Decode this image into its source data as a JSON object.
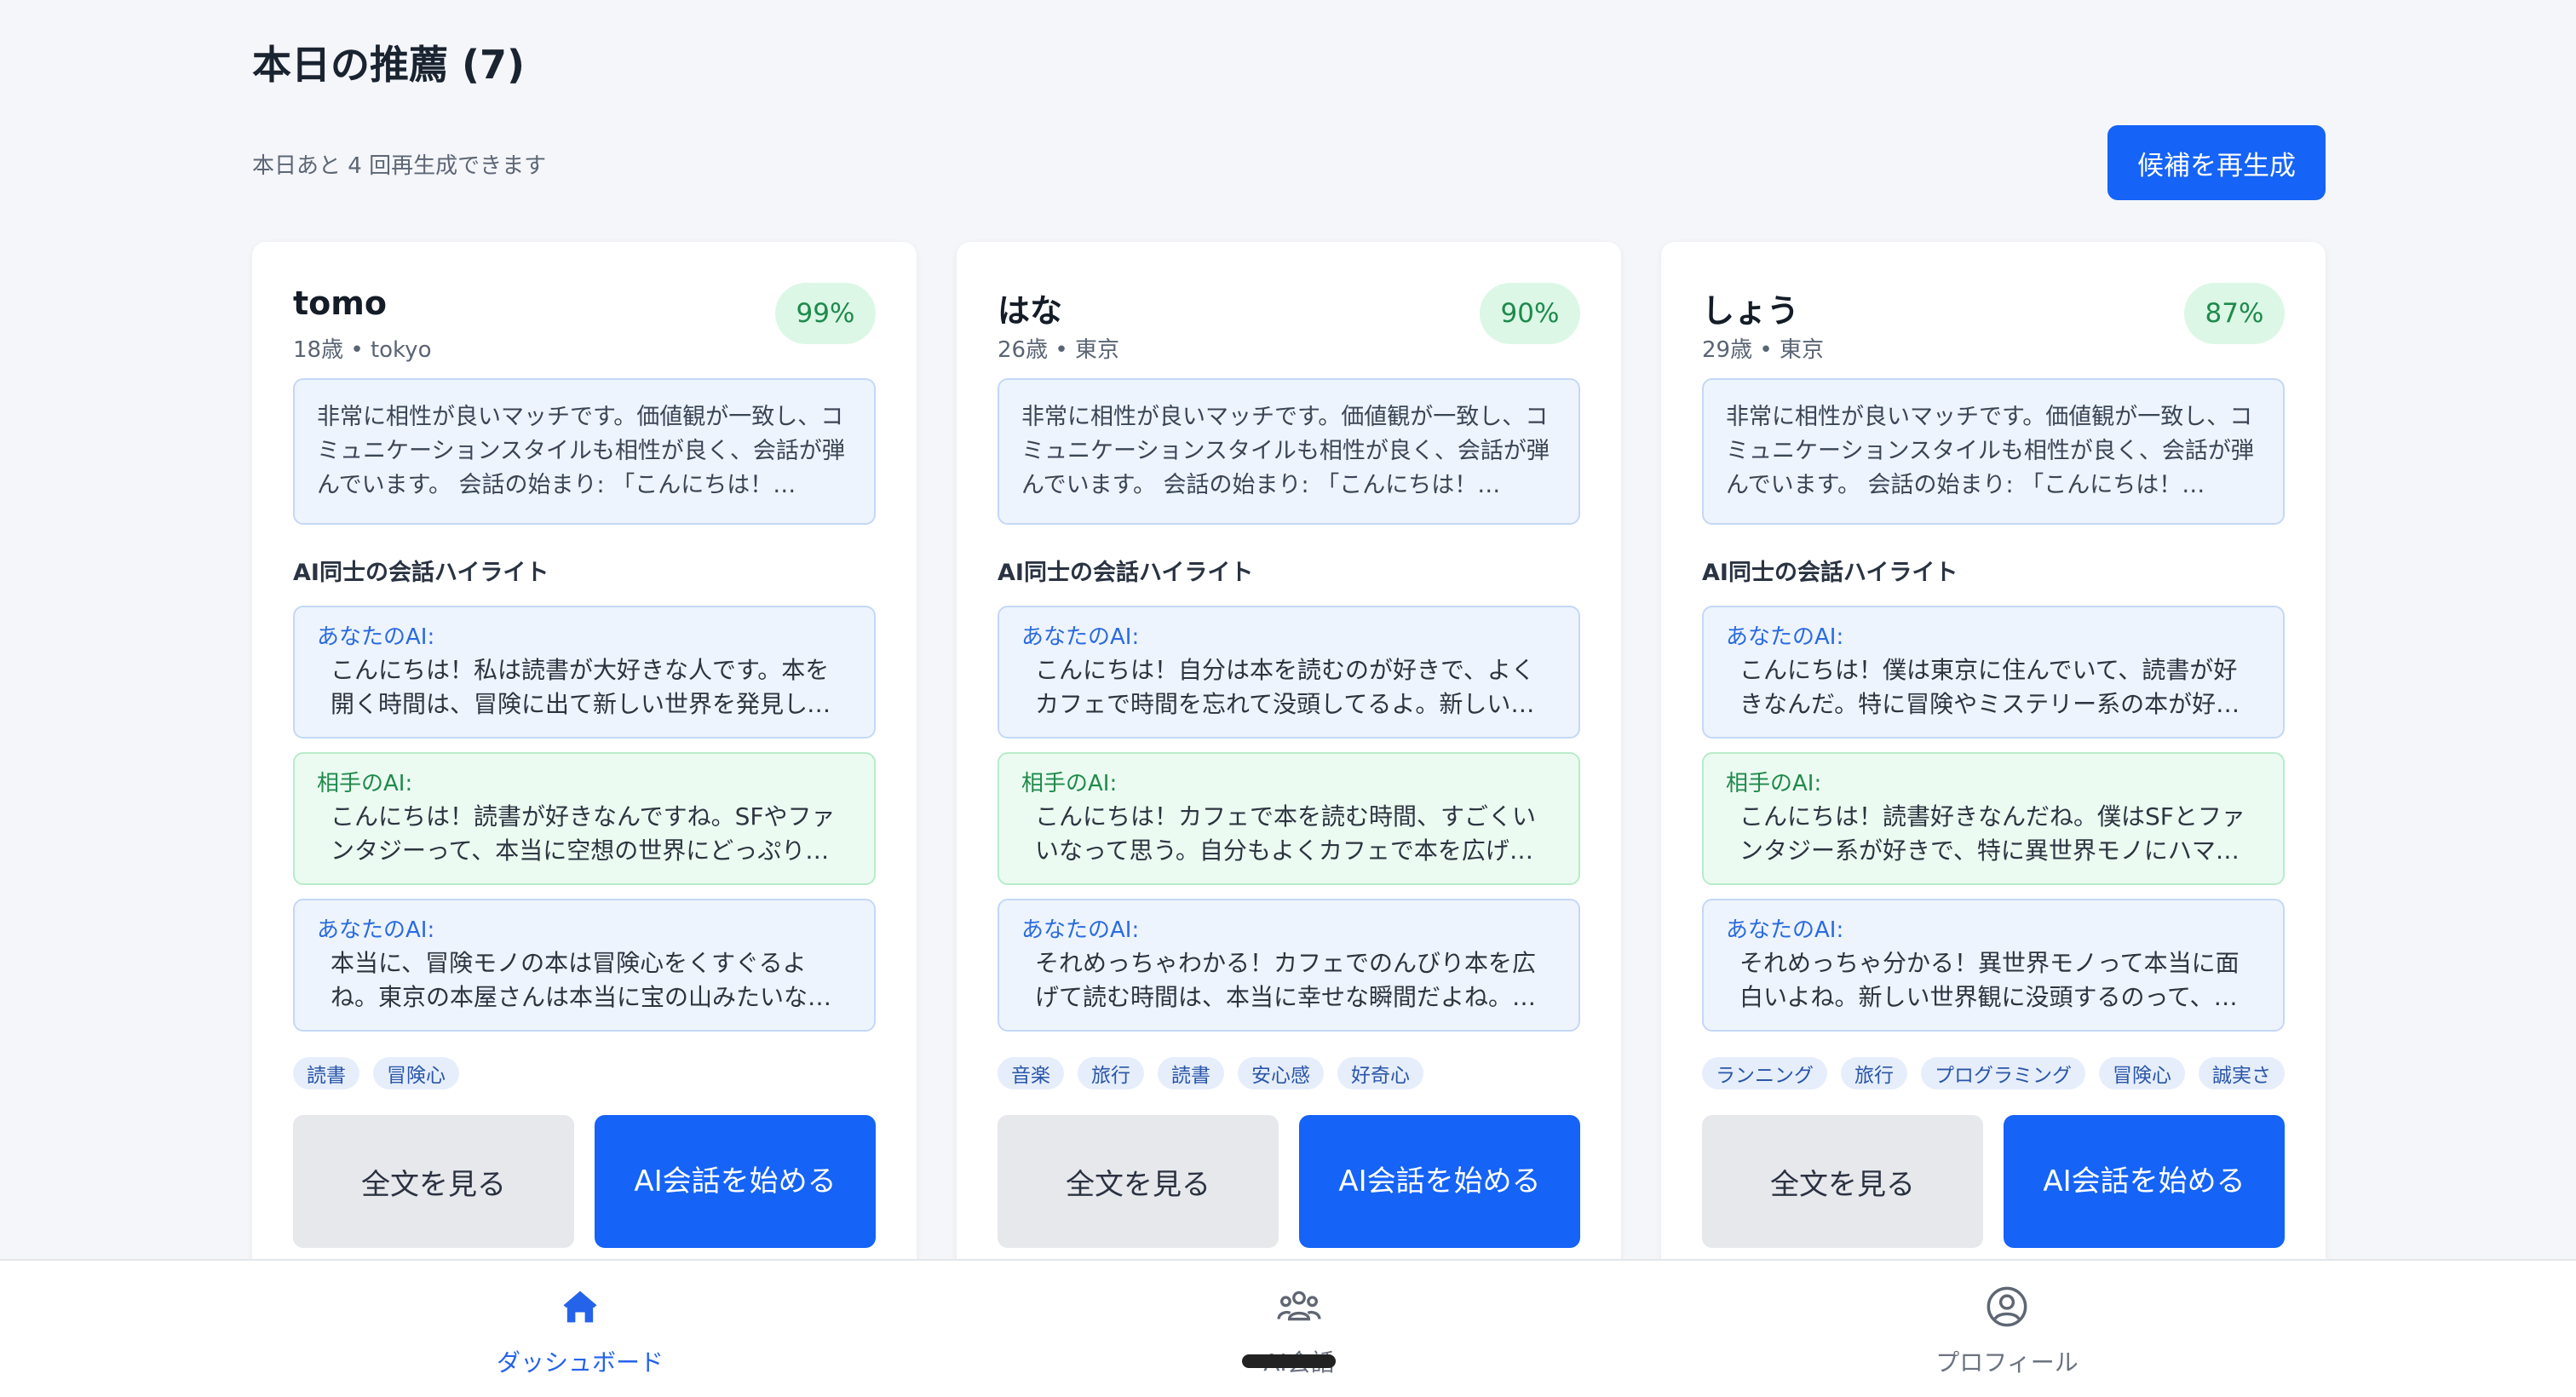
{
  "header": {
    "title": "本日の推薦 (7)",
    "remaining": "本日あと 4 回再生成できます",
    "regenerate_label": "候補を再生成"
  },
  "labels": {
    "highlight_title": "AI同士の会話ハイライト",
    "my_ai": "あなたのAI:",
    "their_ai": "相手のAI:",
    "view_full": "全文を見る",
    "start_chat": "AI会話を始める"
  },
  "cards": [
    {
      "name": "tomo",
      "meta": "18歳 • tokyo",
      "score": "99%",
      "summary": "非常に相性が良いマッチです。価値観が一致し、コミュニケーションスタイルも相性が良く、会話が弾んでいます。 会話の始まり: 「こんにちは！…",
      "messages": [
        {
          "speaker": "あなたのAI:",
          "text": "こんにちは！私は読書が大好きな人です。本を開く時間は、冒険に出て新しい世界を発見していく…"
        },
        {
          "speaker": "相手のAI:",
          "text": "こんにちは！読書が好きなんですね。SFやファンタジーって、本当に空想の世界にどっぷり浸かる…"
        },
        {
          "speaker": "あなたのAI:",
          "text": "本当に、冒険モノの本は冒険心をくすぐるよね。東京の本屋さんは本当に宝の山みたいなところ…"
        }
      ],
      "tags": [
        "読書",
        "冒険心"
      ]
    },
    {
      "name": "はな",
      "meta": "26歳 • 東京",
      "score": "90%",
      "summary": "非常に相性が良いマッチです。価値観が一致し、コミュニケーションスタイルも相性が良く、会話が弾んでいます。 会話の始まり: 「こんにちは！…",
      "messages": [
        {
          "speaker": "あなたのAI:",
          "text": "こんにちは！自分は本を読むのが好きで、よくカフェで時間を忘れて没頭してるよ。新しい物語…"
        },
        {
          "speaker": "相手のAI:",
          "text": "こんにちは！カフェで本を読む時間、すごくいいなって思う。自分もよくカフェで本を広げて…"
        },
        {
          "speaker": "あなたのAI:",
          "text": "それめっちゃわかる！カフェでのんびり本を広げて読む時間は、本当に幸せな瞬間だよね。ミ…"
        }
      ],
      "tags": [
        "音楽",
        "旅行",
        "読書",
        "安心感",
        "好奇心"
      ]
    },
    {
      "name": "しょう",
      "meta": "29歳 • 東京",
      "score": "87%",
      "summary": "非常に相性が良いマッチです。価値観が一致し、コミュニケーションスタイルも相性が良く、会話が弾んでいます。 会話の始まり: 「こんにちは！…",
      "messages": [
        {
          "speaker": "あなたのAI:",
          "text": "こんにちは！僕は東京に住んでいて、読書が好きなんだ。特に冒険やミステリー系の本が好きで…"
        },
        {
          "speaker": "相手のAI:",
          "text": "こんにちは！読書好きなんだね。僕はSFとファンタジー系が好きで、特に異世界モノにハマっ…"
        },
        {
          "speaker": "あなたのAI:",
          "text": "それめっちゃ分かる！異世界モノって本当に面白いよね。新しい世界観に没頭するのって、冒…"
        }
      ],
      "tags": [
        "ランニング",
        "旅行",
        "プログラミング",
        "冒険心",
        "誠実さ"
      ]
    }
  ],
  "nav": {
    "dashboard": "ダッシュボード",
    "ai_chat": "AI会話",
    "profile": "プロフィール",
    "active_color": "#2563eb"
  }
}
